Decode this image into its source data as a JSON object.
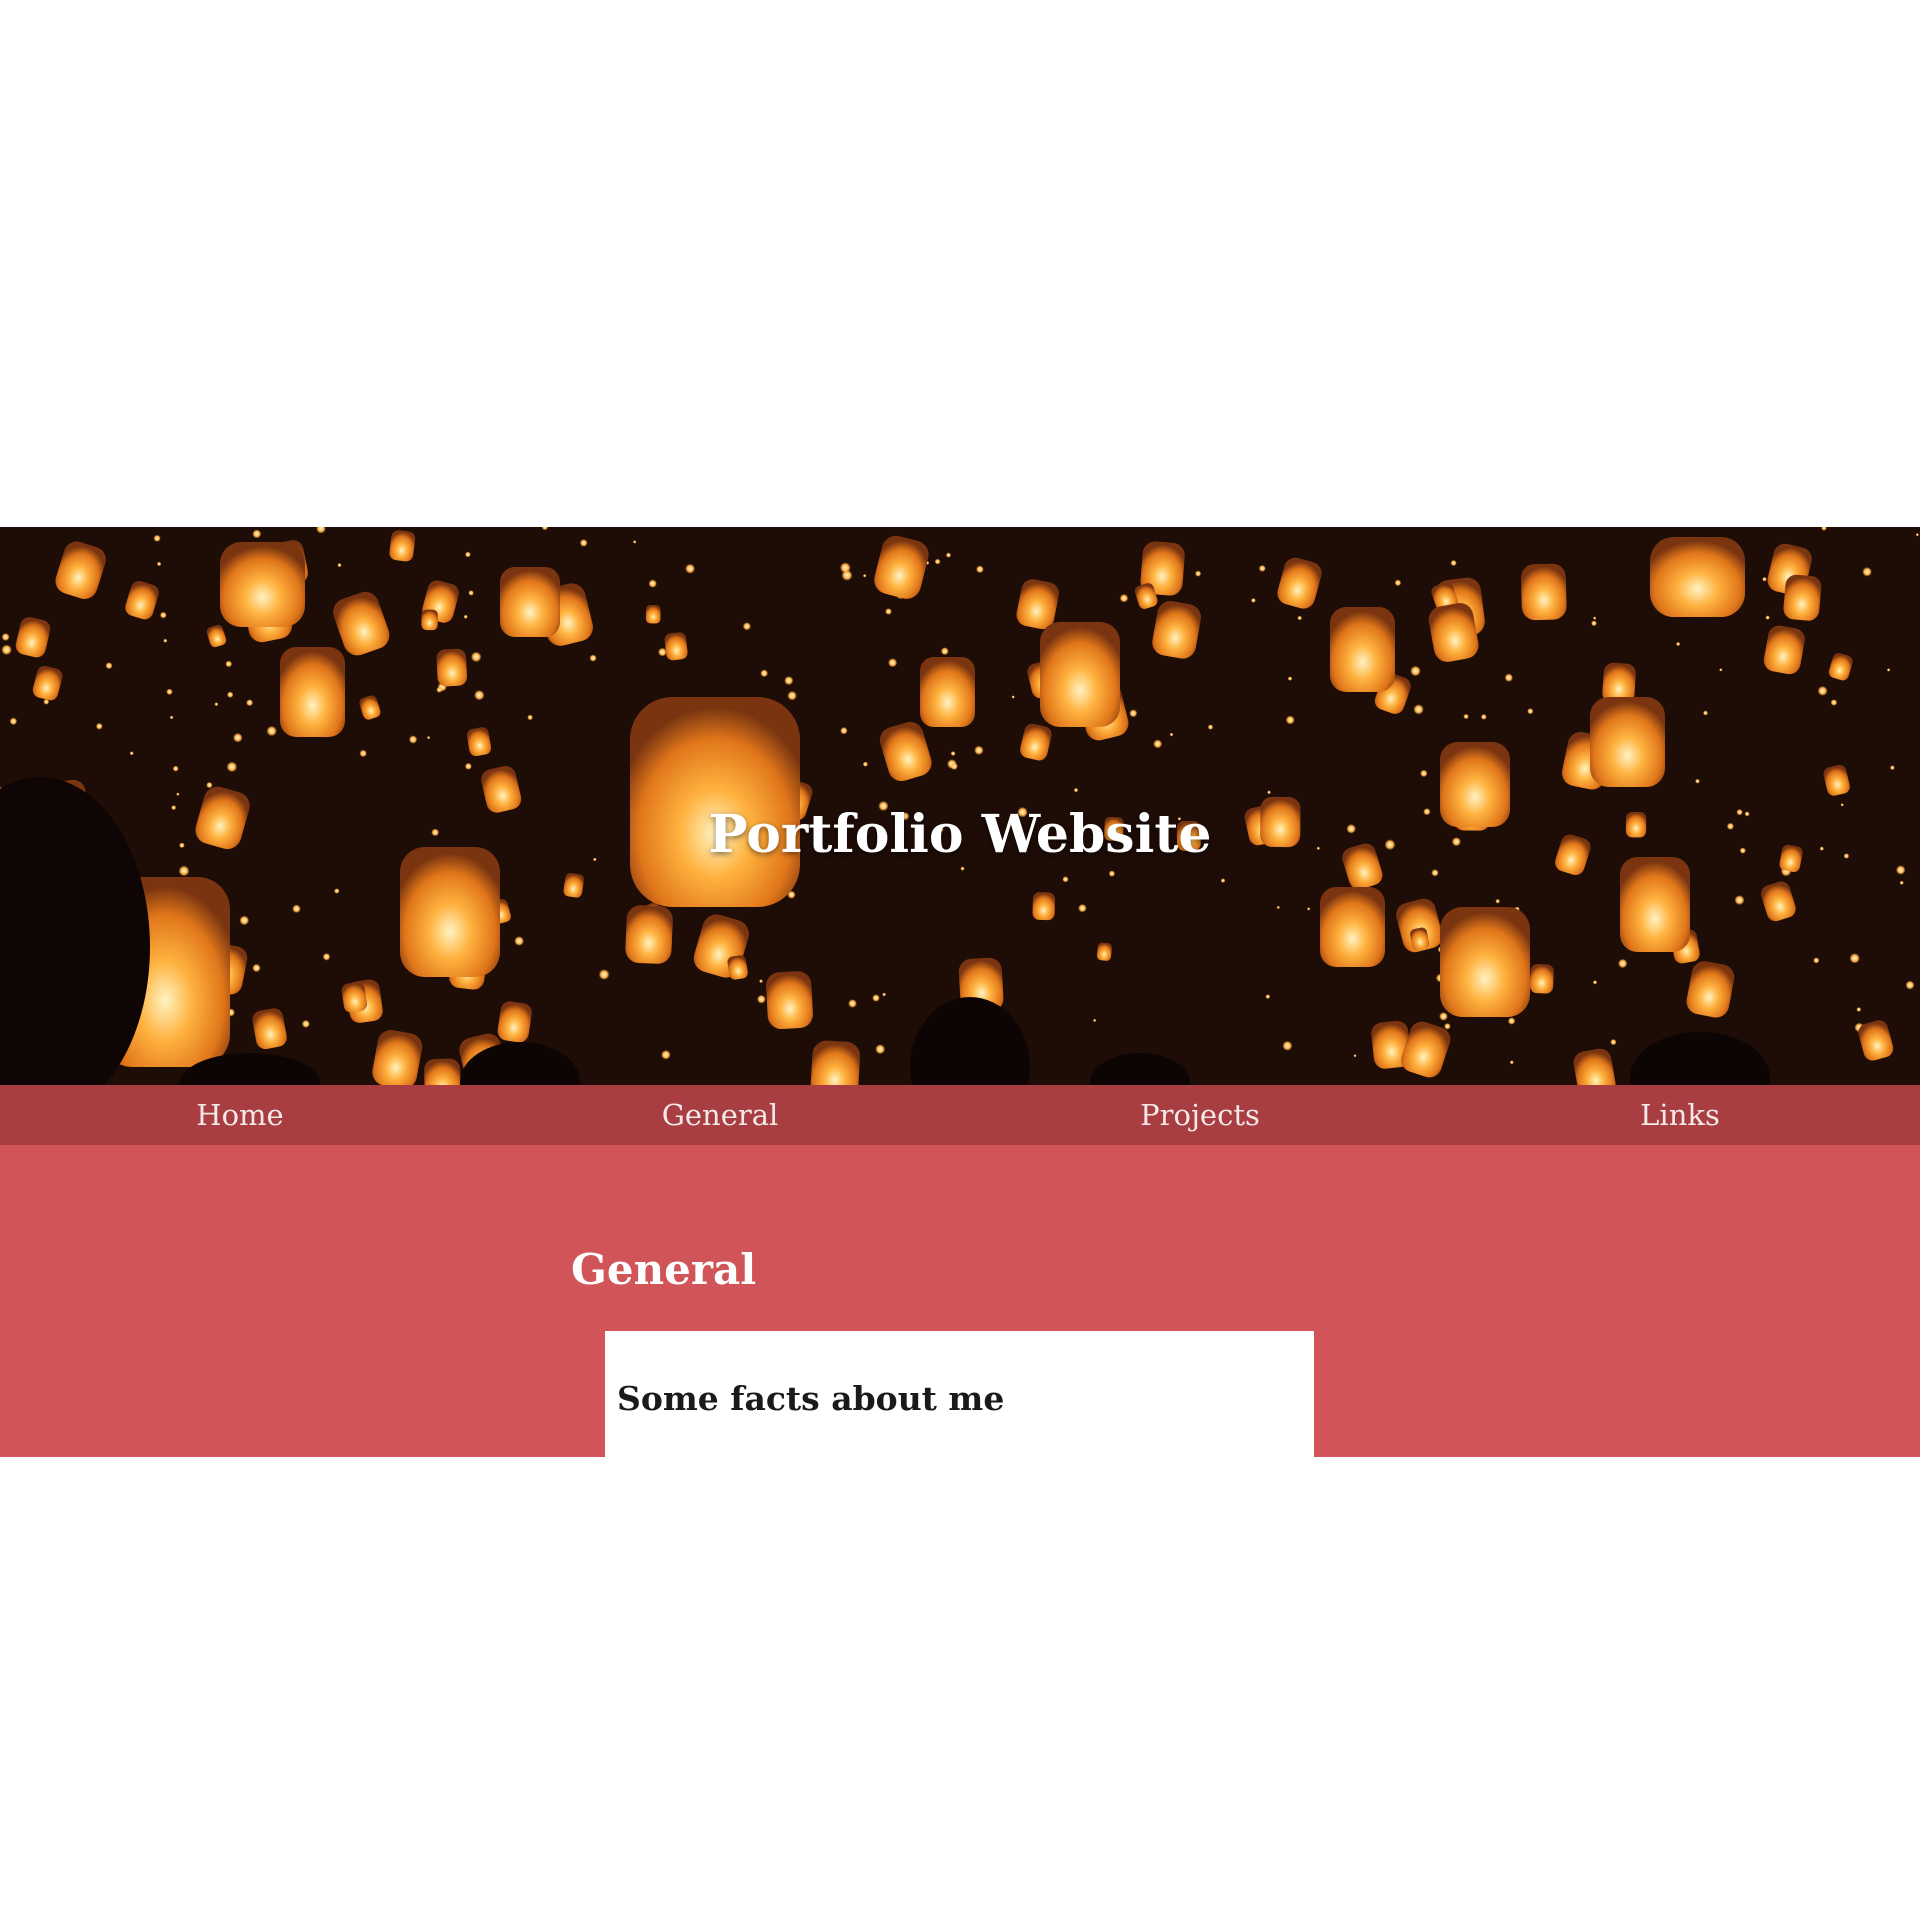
{
  "hero": {
    "title": "Portfolio Website",
    "image_icon": "sky-lanterns-photo"
  },
  "nav": {
    "items": [
      {
        "label": "Home"
      },
      {
        "label": "General"
      },
      {
        "label": "Projects"
      },
      {
        "label": "Links"
      }
    ]
  },
  "general": {
    "heading": "General",
    "card": {
      "heading": "Some facts about me"
    }
  },
  "colors": {
    "nav_bg": "#a83d42",
    "section_bg": "#d05458",
    "card_bg": "#ffffff",
    "hero_bg": "#24100a",
    "lantern_glow": "#ffa733"
  }
}
